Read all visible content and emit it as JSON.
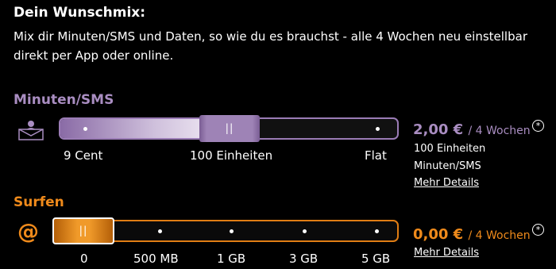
{
  "header": {
    "title": "Dein Wunschmix:",
    "description": "Mix dir Minuten/SMS und Daten, so wie du es brauchst - alle 4 Wochen neu einstellbar direkt per App oder online."
  },
  "minuten": {
    "title": "Minuten/SMS",
    "icon": "mail-person-icon",
    "ticks": [
      "9 Cent",
      "100 Einheiten",
      "Flat"
    ],
    "selected_index": 1,
    "price": "2,00 €",
    "period": "/ 4 Wochen",
    "detail_line1": "100 Einheiten",
    "detail_line2": "Minuten/SMS",
    "link": "Mehr Details",
    "color": "#a98dc1"
  },
  "surfen": {
    "title": "Surfen",
    "icon": "at-sign-icon",
    "ticks": [
      "0",
      "500 MB",
      "1 GB",
      "3 GB",
      "5 GB"
    ],
    "selected_index": 0,
    "price": "0,00 €",
    "period": "/ 4 Wochen",
    "link": "Mehr Details",
    "color": "#ef8a1b"
  }
}
